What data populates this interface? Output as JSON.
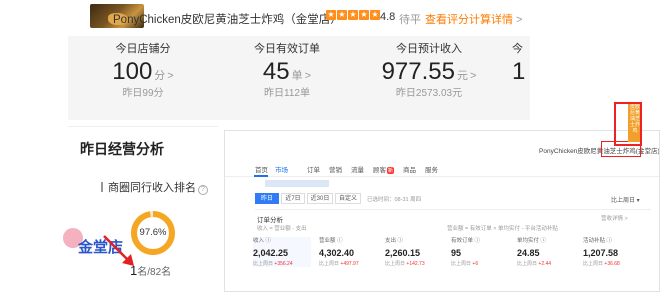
{
  "header": {
    "store_name": "PonyChicken皮欧尼黄油芝士炸鸡（金堂店）",
    "stars": [
      "★",
      "★",
      "★",
      "★",
      "★"
    ],
    "rating": "4.8",
    "rating_label": "待平",
    "review_link": "查看评分计算详情",
    "review_chevron": ">"
  },
  "stats": [
    {
      "label": "今日店铺分",
      "value": "100",
      "unit": "分",
      "chevron": ">",
      "sub": "昨日99分"
    },
    {
      "label": "今日有效订单",
      "value": "45",
      "unit": "单",
      "chevron": ">",
      "sub": "昨日112单"
    },
    {
      "label": "今日预计收入",
      "value": "977.55",
      "unit": "元",
      "chevron": ">",
      "sub": "昨日2573.03元"
    },
    {
      "label": "今",
      "value": "1",
      "unit": "",
      "chevron": "",
      "sub": ""
    }
  ],
  "analysis": {
    "title": "昨日经营分析",
    "rank_label": "商圈同行收入排名",
    "help_icon": "?",
    "ring_percent": 97.6,
    "ring_text": "97.6%",
    "rank_num": "1",
    "rank_total": "名/82名",
    "colors": {
      "ring": "#f5a623",
      "ring_bg": "#fde9c7"
    }
  },
  "annotation": {
    "text": "金堂店",
    "colors": {
      "text": "#2b56c9",
      "arrow": "#e22222",
      "dot": "#f2a3b4"
    }
  },
  "shot": {
    "store": "PonyChicken皮欧尼黄油芝士炸鸡(金堂店)",
    "tabs": [
      {
        "label": "首页",
        "active": false
      },
      {
        "label": "市场",
        "active": true
      },
      {
        "label": "订单",
        "active": false
      },
      {
        "label": "营销",
        "active": false
      },
      {
        "label": "流量",
        "active": false
      },
      {
        "label": "顾客",
        "active": false,
        "badge": "新"
      },
      {
        "label": "商品",
        "active": false
      },
      {
        "label": "服务",
        "active": false
      }
    ],
    "filters": [
      {
        "label": "昨日",
        "on": true
      },
      {
        "label": "近7日",
        "on": false
      },
      {
        "label": "近30日",
        "on": false
      },
      {
        "label": "自定义",
        "on": false
      }
    ],
    "date_note": "已选时间：08-31 周四",
    "compare_top": "比上周日 ▾",
    "section_title": "订单分析",
    "formula1": "收入 = 营业额 - 支出",
    "formula2": "营业额 = 有效订单 × 单均实付 - 平台活动补贴",
    "detail_link": "营收详情 >",
    "metrics": [
      {
        "label": "收入 ⓘ",
        "value": "2,042.25",
        "comp": "比上周日",
        "delta": "+356.24"
      },
      {
        "label": "营业额 ⓘ",
        "value": "4,302.40",
        "comp": "比上周日",
        "delta": "+497.97"
      },
      {
        "label": "支出 ⓘ",
        "value": "2,260.15",
        "comp": "比上周日",
        "delta": "+142.73"
      },
      {
        "label": "有效订单 ⓘ",
        "value": "95",
        "comp": "比上周日",
        "delta": "+6"
      },
      {
        "label": "单均实付 ⓘ",
        "value": "24.85",
        "comp": "比上周日",
        "delta": "+2.44"
      },
      {
        "label": "活动补贴 ⓘ",
        "value": "1,207.58",
        "comp": "比上周日",
        "delta": "+36.68"
      }
    ]
  },
  "vbanner": "皮欧尼黄油芝士炸鸡",
  "colors": {
    "accent": "#ff7a00",
    "star": "#ff8e1a",
    "band_bg": "#f5f5f5",
    "link_blue": "#1a73e8",
    "red": "#e22222"
  }
}
